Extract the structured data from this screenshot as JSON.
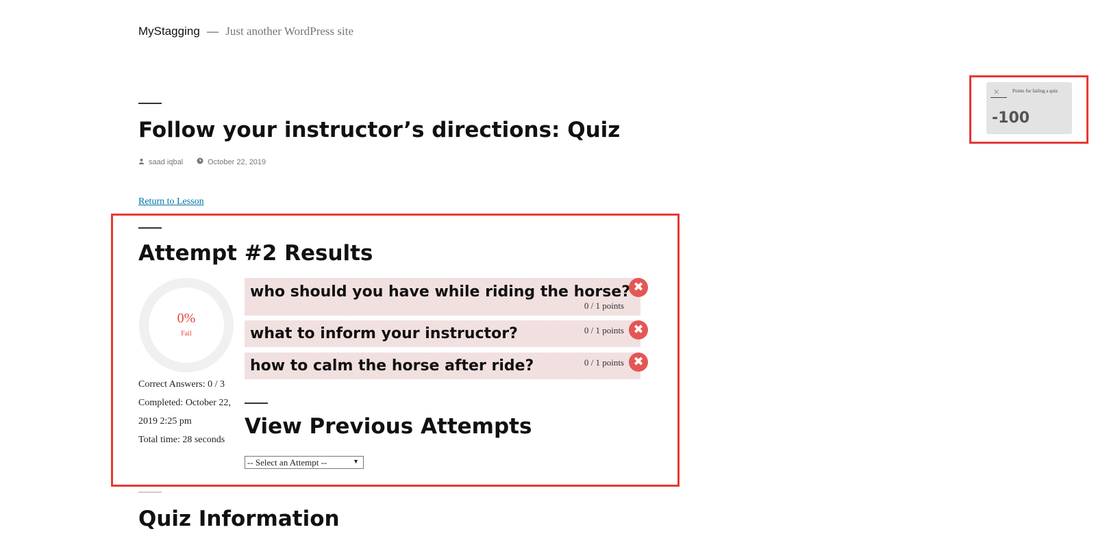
{
  "site": {
    "title": "MyStagging",
    "separator": "—",
    "description": "Just another WordPress site"
  },
  "entry": {
    "title": "Follow your instructor’s directions: Quiz",
    "author": "saad iqbal",
    "date": "October 22, 2019",
    "return_link": "Return to Lesson"
  },
  "results": {
    "title": "Attempt #2 Results",
    "score_percent": "0%",
    "status": "Fail",
    "score_fraction": 0,
    "stats": {
      "correct_answers": "Correct Answers: 0 / 3",
      "completed_line1": "Completed: October 22,",
      "completed_line2": "2019 2:25 pm",
      "total_time": "Total time: 28 seconds"
    },
    "questions": [
      {
        "text": "who should you have while riding the horse?",
        "points": "0 / 1 points",
        "badge_icon": "✖"
      },
      {
        "text": "what to inform your instructor?",
        "points": "0 / 1 points",
        "badge_icon": "✖"
      },
      {
        "text": "how to calm the horse after ride?",
        "points": "0 / 1 points",
        "badge_icon": "✖"
      }
    ],
    "colors": {
      "fail": "#e1453b",
      "question_bg": "#f0dddd",
      "badge": "#e45654",
      "highlight_border": "#e53935"
    }
  },
  "previous_attempts": {
    "title": "View Previous Attempts",
    "select_value": "-- Select an Attempt --",
    "select_arrow": "▼"
  },
  "quiz_info": {
    "title": "Quiz Information"
  },
  "notification": {
    "close_icon": "✕",
    "label": "Points for failing a quiz",
    "value": "-100"
  }
}
